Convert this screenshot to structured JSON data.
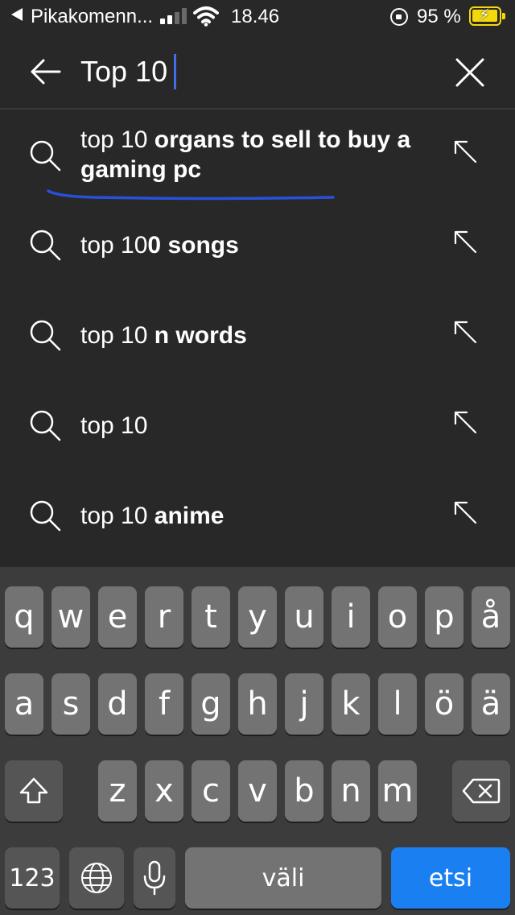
{
  "status_bar": {
    "carrier": "Pikakomenn...",
    "time": "18.46",
    "battery_percent": "95 %",
    "signal_bars": 2,
    "accent_color": "#f5d90a"
  },
  "search": {
    "query": "Top 10",
    "back_icon": "arrow-left-icon",
    "clear_icon": "close-icon"
  },
  "suggestions": [
    {
      "typed": "top 10",
      "rest": " organs to sell to buy a gaming pc"
    },
    {
      "typed": "top 10",
      "rest": "0 songs"
    },
    {
      "typed": "top 10",
      "rest": " n words"
    },
    {
      "typed": "top 10",
      "rest": ""
    },
    {
      "typed": "top 10",
      "rest": " anime"
    }
  ],
  "keyboard": {
    "row1": [
      "q",
      "w",
      "e",
      "r",
      "t",
      "y",
      "u",
      "i",
      "o",
      "p",
      "å"
    ],
    "row2": [
      "a",
      "s",
      "d",
      "f",
      "g",
      "h",
      "j",
      "k",
      "l",
      "ö",
      "ä"
    ],
    "row3": [
      "z",
      "x",
      "c",
      "v",
      "b",
      "n",
      "m"
    ],
    "numbers_label": "123",
    "space_label": "väli",
    "search_label": "etsi",
    "search_key_color": "#1a7ff0"
  }
}
